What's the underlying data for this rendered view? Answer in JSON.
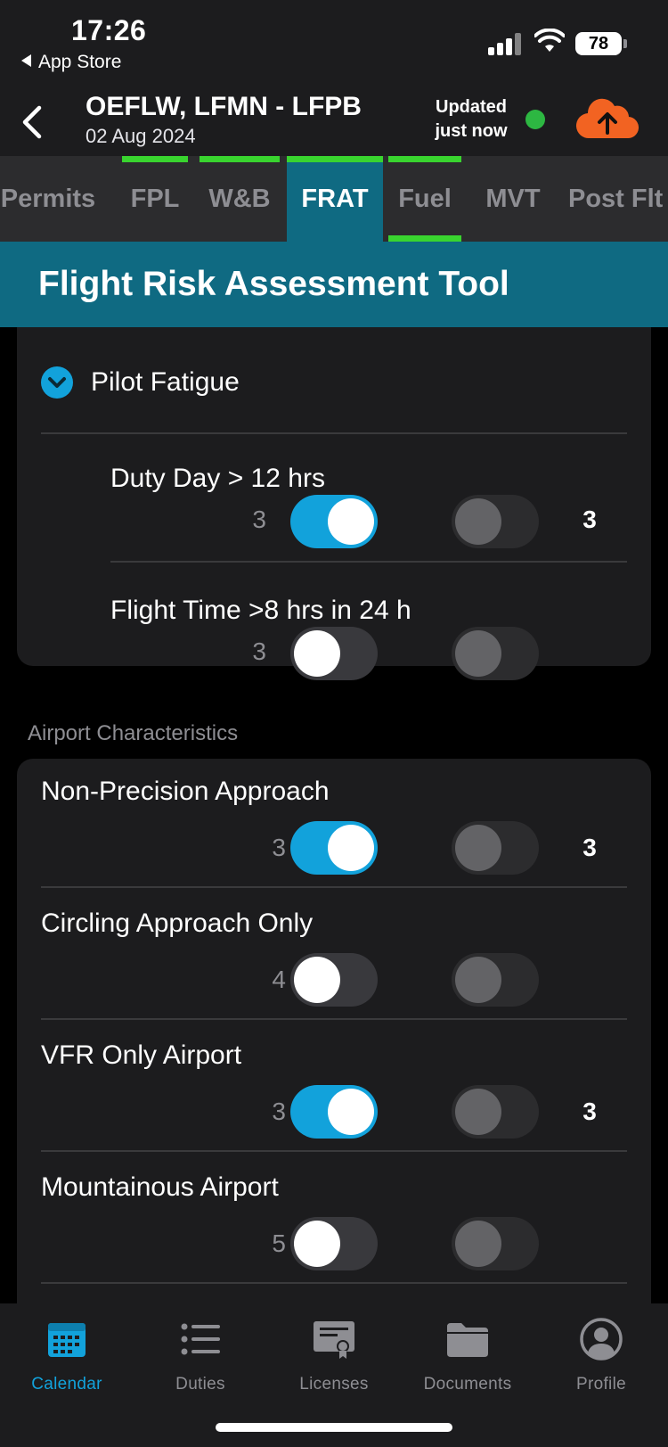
{
  "status_bar": {
    "time": "17:26",
    "back_app": "App Store",
    "battery": "78"
  },
  "header": {
    "title": "OEFLW, LFMN - LFPB",
    "date": "02 Aug 2024",
    "updated_line1": "Updated",
    "updated_line2": "just now",
    "status_color": "#2db742",
    "upload_color": "#f26322"
  },
  "tabs": [
    "Permits",
    "FPL",
    "W&B",
    "FRAT",
    "Fuel",
    "MVT",
    "Post Flt"
  ],
  "active_tab": "FRAT",
  "banner": {
    "title": "Flight Risk Assessment Tool"
  },
  "pilot_fatigue": {
    "label": "Pilot Fatigue",
    "items": [
      {
        "label": "Duty Day > 12 hrs",
        "score": "3",
        "toggle_on": true,
        "result": "3"
      },
      {
        "label": "Flight Time >8 hrs in 24 h",
        "score": "3",
        "toggle_on": false,
        "result": ""
      }
    ]
  },
  "airport": {
    "section_title": "Airport Characteristics",
    "items": [
      {
        "label": "Non-Precision Approach",
        "score": "3",
        "toggle_on": true,
        "result": "3"
      },
      {
        "label": "Circling Approach Only",
        "score": "4",
        "toggle_on": false,
        "result": ""
      },
      {
        "label": "VFR Only Airport",
        "score": "3",
        "toggle_on": true,
        "result": "3"
      },
      {
        "label": "Mountainous Airport",
        "score": "5",
        "toggle_on": false,
        "result": ""
      }
    ]
  },
  "tabbar": {
    "items": [
      {
        "label": "Calendar",
        "icon": "calendar-icon"
      },
      {
        "label": "Duties",
        "icon": "list-icon"
      },
      {
        "label": "Licenses",
        "icon": "certificate-icon"
      },
      {
        "label": "Documents",
        "icon": "folder-icon"
      },
      {
        "label": "Profile",
        "icon": "person-icon"
      }
    ],
    "active": "Calendar",
    "accent": "#12a2db"
  }
}
